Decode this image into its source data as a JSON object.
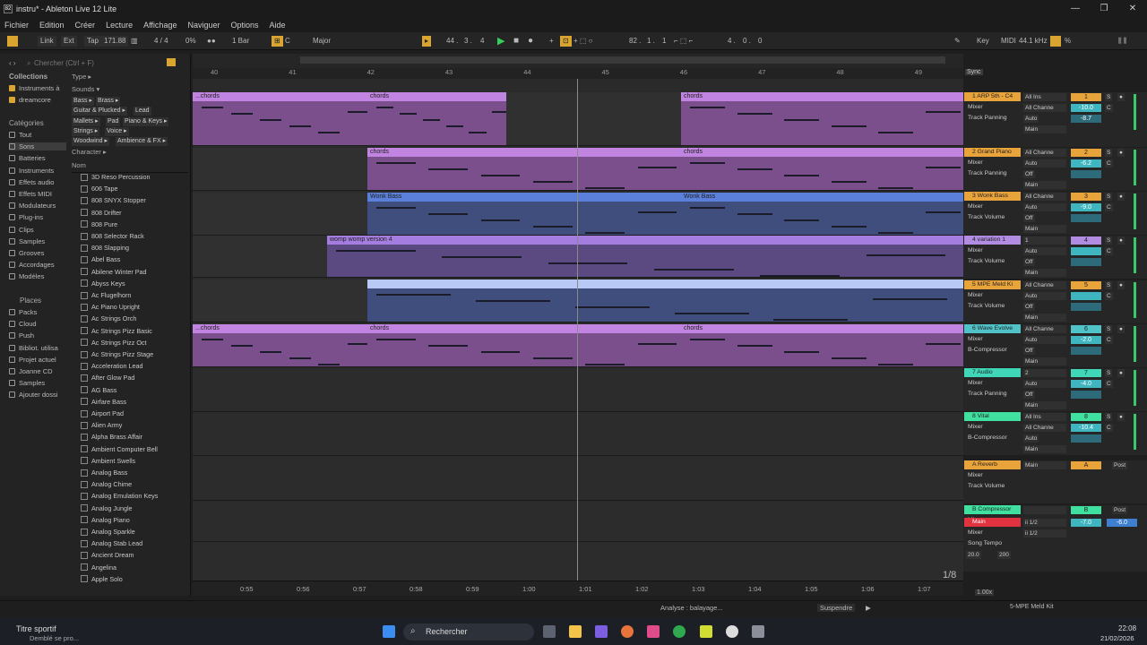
{
  "window": {
    "title": "instru* - Ableton Live 12 Lite",
    "icon_text": "82",
    "controls": [
      "—",
      "❐",
      "✕"
    ]
  },
  "menu": [
    "Fichier",
    "Edition",
    "Créer",
    "Lecture",
    "Affichage",
    "Naviguer",
    "Options",
    "Aide"
  ],
  "transport": {
    "link": "Link",
    "ext": "Ext",
    "tap": "Tap",
    "tempo": "171.88",
    "signature": "4 / 4",
    "percent": "0%",
    "quant": "1 Bar",
    "key": "C",
    "scale": "Major",
    "pos1": "44 .",
    "pos2": "3 .",
    "pos3": "4",
    "loop1": "82 .",
    "loop2": "1 .",
    "loop3": "1",
    "loopend1": "4 .",
    "loopend2": "0 .",
    "loopend3": "0",
    "keylabel": "Key",
    "midi": "MIDI",
    "samplerate": "44.1 kHz",
    "cpu": "%"
  },
  "browser": {
    "search_placeholder": "Chercher (Ctrl + F)",
    "collections_header": "Collections",
    "collections": [
      "Instruments à",
      "dreamcore"
    ],
    "categories_header": "Catégories",
    "categories": [
      "Tout",
      "Sons",
      "Batteries",
      "Instruments",
      "Effets audio",
      "Effets MIDI",
      "Modulateurs",
      "Plug-ins",
      "Clips",
      "Samples",
      "Grooves",
      "Accordages",
      "Modèles"
    ],
    "places_header": "Places",
    "places": [
      "Packs",
      "Cloud",
      "Push",
      "Bibliot. utilisa",
      "Projet actuel",
      "Joanne CD",
      "Samples",
      "Ajouter dossi"
    ],
    "filter_type": "Type ▸",
    "filter_sounds": "Sounds ▾",
    "tags": [
      "Bass ▸",
      "Brass ▸",
      "Guitar & Plucked ▸",
      "Lead",
      "Mallets ▸",
      "Pad",
      "Piano & Keys ▸",
      "Strings ▸",
      "Voice ▸",
      "Woodwind ▸",
      "Ambience & FX ▸"
    ],
    "filter_character": "Character ▸",
    "col_name": "Nom",
    "items": [
      "3D Reso Percussion",
      "606 Tape",
      "808 SNYX Stopper",
      "808 Drifter",
      "808 Pure",
      "808 Selector Rack",
      "808 Slapping",
      "Abel Bass",
      "Abilene Winter Pad",
      "Abyss Keys",
      "Ac Flugelhorn",
      "Ac Piano Upright",
      "Ac Strings Orch",
      "Ac Strings Pizz Basic",
      "Ac Strings Pizz Oct",
      "Ac Strings Pizz Stage",
      "Acceleration Lead",
      "After Glow Pad",
      "AG Bass",
      "Airfare Bass",
      "Airport Pad",
      "Alien Army",
      "Alpha Brass Affair",
      "Ambient Computer Bell",
      "Ambient Swells",
      "Analog Bass",
      "Analog Chime",
      "Analog Emulation Keys",
      "Analog Jungle",
      "Analog Piano",
      "Analog Sparkle",
      "Analog Stab Lead",
      "Ancient Dream",
      "Angelina",
      "Apple Solo"
    ]
  },
  "arrangement": {
    "bars": [
      "40",
      "41",
      "42",
      "43",
      "44",
      "45",
      "46",
      "47",
      "48",
      "49"
    ],
    "sync": "Sync",
    "zoom_fraction": "1/8",
    "times": [
      "0:55",
      "0:56",
      "0:57",
      "0:58",
      "0:59",
      "1:00",
      "1:01",
      "1:02",
      "1:03",
      "1:04",
      "1:05",
      "1:06",
      "1:07"
    ],
    "clips": {
      "chords_start": "...chords",
      "chords": "chords",
      "wonk": "Wonk Bass",
      "womp": "womp womp version 4"
    }
  },
  "tracks": [
    {
      "name": "1 ARP 5th - C4",
      "num": "1",
      "input": "All Ins",
      "chan": "All Channe",
      "dev1": "Mixer",
      "dev2": "Track Panning",
      "vol": "-10.0",
      "pan": "-8.7",
      "mon": "Auto",
      "out": "Main",
      "color": "#e9a33b"
    },
    {
      "name": "2 Grand Piano",
      "num": "2",
      "input": "All Channe",
      "chan": "Auto",
      "dev1": "Mixer",
      "dev2": "Track Panning",
      "vol": "-6.2",
      "pan": "",
      "mon": "Off",
      "out": "Main",
      "color": "#e9a33b"
    },
    {
      "name": "3 Wonk Bass",
      "num": "3",
      "input": "All Channe",
      "chan": "Auto",
      "dev1": "Mixer",
      "dev2": "Track Volume",
      "vol": "-9.0",
      "pan": "",
      "mon": "Off",
      "out": "Main",
      "color": "#e9a33b"
    },
    {
      "name": "4 variation 1",
      "num": "4",
      "input": "1",
      "chan": "Auto",
      "dev1": "Mixer",
      "dev2": "Track Volume",
      "vol": "",
      "pan": "",
      "mon": "Off",
      "out": "Main",
      "color": "#b28be3"
    },
    {
      "name": "5 MPE Meld Ki",
      "num": "5",
      "input": "All Channe",
      "chan": "Auto",
      "dev1": "Mixer",
      "dev2": "Track Volume",
      "vol": "",
      "pan": "",
      "mon": "Off",
      "out": "Main",
      "color": "#e9a33b"
    },
    {
      "name": "6 Wave Evolve",
      "num": "6",
      "input": "All Channe",
      "chan": "Auto",
      "dev1": "Mixer",
      "dev2": "B-Compressor",
      "vol": "-2.0",
      "pan": "",
      "mon": "Off",
      "out": "Main",
      "color": "#4fc3c8"
    },
    {
      "name": "7 Audio",
      "num": "7",
      "input": "2",
      "chan": "Auto",
      "dev1": "Mixer",
      "dev2": "Track Panning",
      "vol": "-4.0",
      "pan": "",
      "mon": "Off",
      "out": "Main",
      "color": "#3fd7b8"
    },
    {
      "name": "8 Vital",
      "num": "8",
      "input": "All Ins",
      "chan": "All Channe",
      "dev1": "Mixer",
      "dev2": "B-Compressor",
      "vol": "-10.4",
      "pan": "",
      "mon": "Auto",
      "out": "Main",
      "color": "#3fe0a0"
    }
  ],
  "returns": [
    {
      "name": "A Reverb",
      "letter": "A",
      "dev1": "Mixer",
      "dev2": "Track Volume",
      "out": "Main",
      "post": "Post",
      "color": "#e9a33b"
    },
    {
      "name": "B Compressor",
      "letter": "B",
      "dev1": "Mixer",
      "dev2": "",
      "out": "",
      "post": "Post",
      "color": "#3fe0a0"
    }
  ],
  "main": {
    "name": "Main",
    "in1": "ii 1/2",
    "in2": "ii 1/2",
    "dev1": "Mixer",
    "dev2": "Song Tempo",
    "tmin": "20.0",
    "tmax": "200",
    "vol": "-7.0",
    "pan": "-6.0"
  },
  "status": {
    "analysis": "Analyse : balayage...",
    "suspend": "Suspendre",
    "clipname": "5-MPE Meld Kit",
    "zoom": "1.00x"
  },
  "taskbar": {
    "weather_title": "Titre sportif",
    "weather_sub": "Demblé se pro...",
    "search": "Rechercher",
    "time": "22:08",
    "date": "21/02/2026"
  }
}
